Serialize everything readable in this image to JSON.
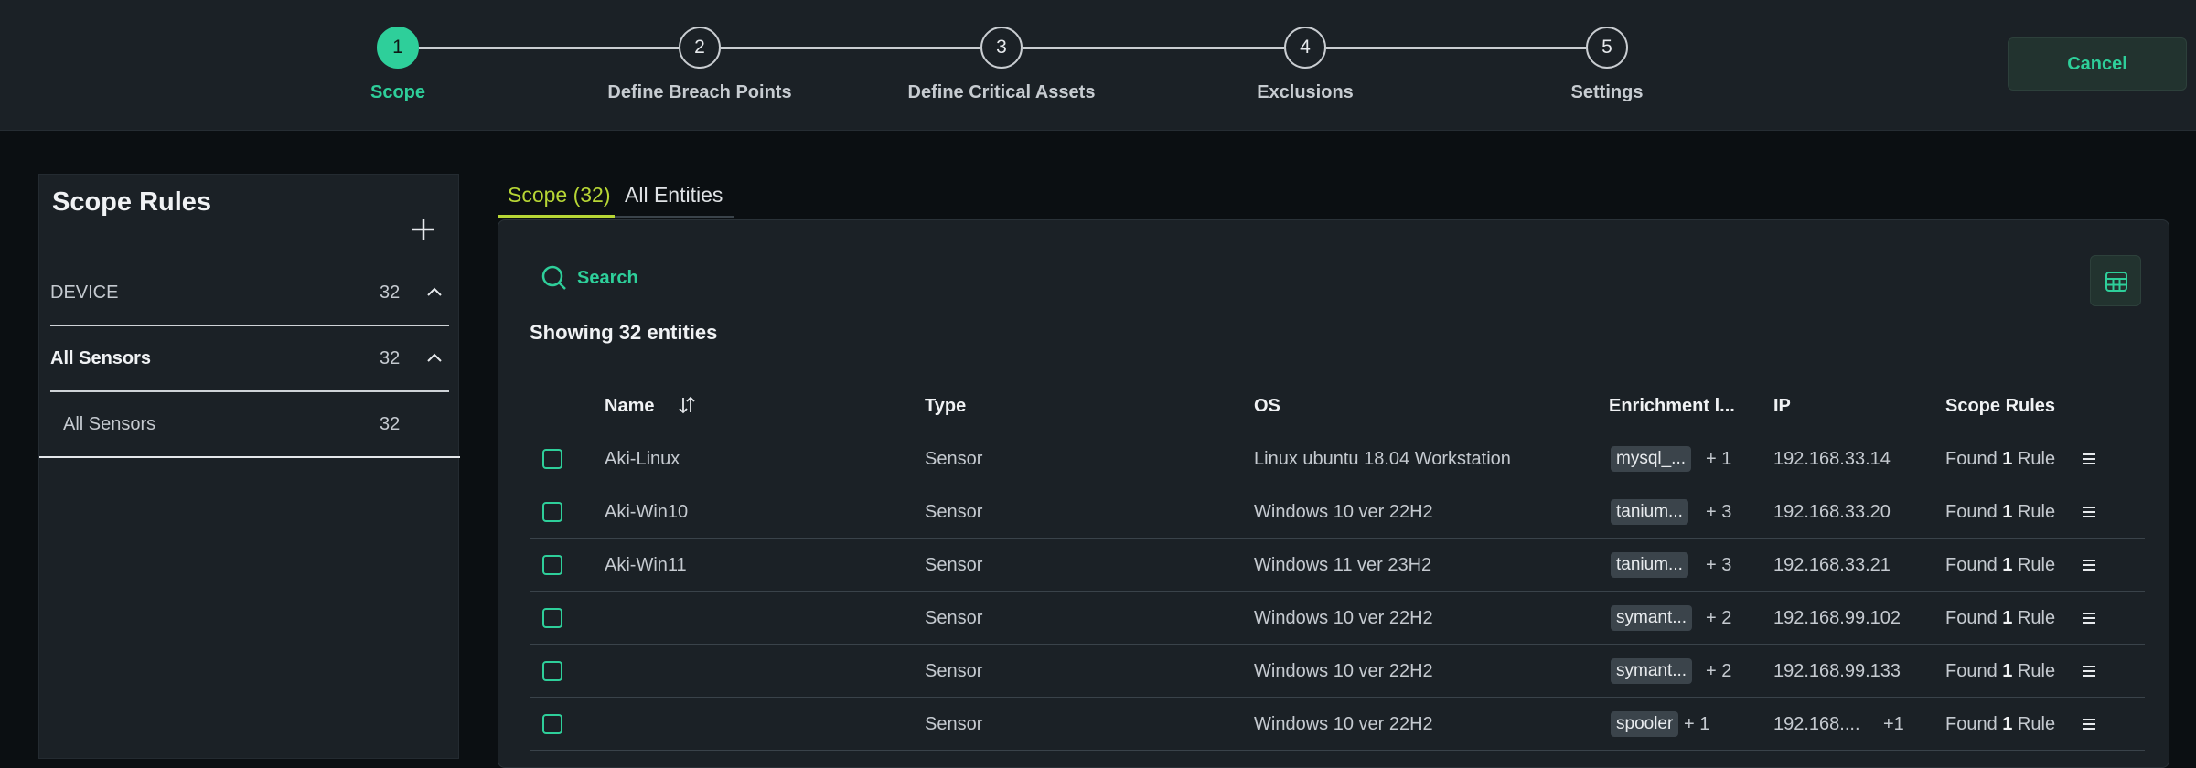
{
  "stepper": {
    "steps": [
      {
        "number": "1",
        "label": "Scope",
        "active": true
      },
      {
        "number": "2",
        "label": "Define Breach Points",
        "active": false
      },
      {
        "number": "3",
        "label": "Define Critical Assets",
        "active": false
      },
      {
        "number": "4",
        "label": "Exclusions",
        "active": false
      },
      {
        "number": "5",
        "label": "Settings",
        "active": false
      }
    ],
    "cancel_label": "Cancel"
  },
  "left_panel": {
    "title": "Scope Rules",
    "add_icon": "plus-icon",
    "groups": [
      {
        "label": "DEVICE",
        "count": "32"
      },
      {
        "label": "All Sensors",
        "count": "32"
      }
    ],
    "sub_item": {
      "label": "All Sensors",
      "count": "32"
    }
  },
  "tabs": [
    {
      "label": "Scope (32)",
      "active": true
    },
    {
      "label": "All Entities",
      "active": false
    }
  ],
  "main": {
    "search_label": "Search",
    "showing": "Showing 32 entities",
    "columns": [
      "Name",
      "Type",
      "OS",
      "Enrichment l...",
      "IP",
      "Scope Rules"
    ],
    "rows": [
      {
        "name": "Aki-Linux",
        "type": "Sensor",
        "os": "Linux ubuntu 18.04 Workstation",
        "enrichment": "mysql_...",
        "more": "+ 1",
        "ip": "192.168.33.14",
        "ip_more": "",
        "found_prefix": "Found",
        "found_count": "1",
        "found_suffix": "Rule"
      },
      {
        "name": "Aki-Win10",
        "type": "Sensor",
        "os": "Windows 10 ver 22H2",
        "enrichment": "tanium...",
        "more": "+ 3",
        "ip": "192.168.33.20",
        "ip_more": "",
        "found_prefix": "Found",
        "found_count": "1",
        "found_suffix": "Rule"
      },
      {
        "name": "Aki-Win11",
        "type": "Sensor",
        "os": "Windows 11 ver 23H2",
        "enrichment": "tanium...",
        "more": "+ 3",
        "ip": "192.168.33.21",
        "ip_more": "",
        "found_prefix": "Found",
        "found_count": "1",
        "found_suffix": "Rule"
      },
      {
        "name": "",
        "type": "Sensor",
        "os": "Windows 10 ver 22H2",
        "enrichment": "symant...",
        "more": "+ 2",
        "ip": "192.168.99.102",
        "ip_more": "",
        "found_prefix": "Found",
        "found_count": "1",
        "found_suffix": "Rule"
      },
      {
        "name": "",
        "type": "Sensor",
        "os": "Windows 10 ver 22H2",
        "enrichment": "symant...",
        "more": "+ 2",
        "ip": "192.168.99.133",
        "ip_more": "",
        "found_prefix": "Found",
        "found_count": "1",
        "found_suffix": "Rule"
      },
      {
        "name": "",
        "type": "Sensor",
        "os": "Windows 10 ver 22H2",
        "enrichment": "spooler",
        "more": "+ 1",
        "ip": "192.168....",
        "ip_more": "+1",
        "found_prefix": "Found",
        "found_count": "1",
        "found_suffix": "Rule"
      }
    ]
  },
  "colors": {
    "accent": "#2ecf9a",
    "tab_active": "#b7d635",
    "background": "#0b0f12",
    "panel": "#1b2126"
  }
}
